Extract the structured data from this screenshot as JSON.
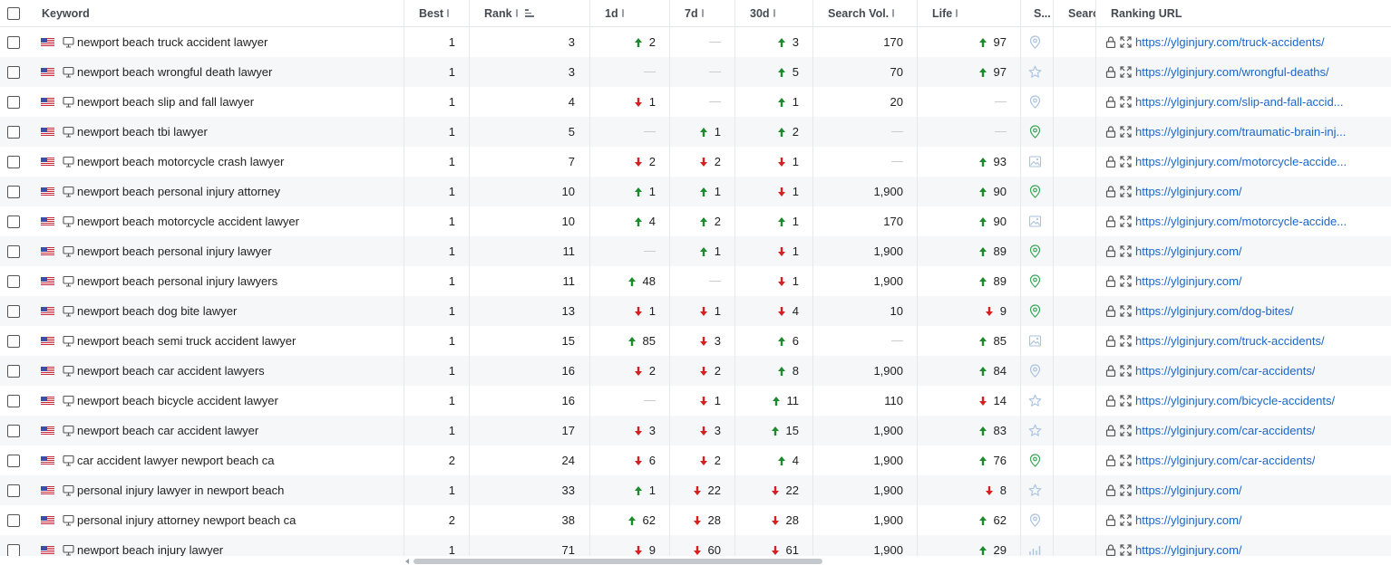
{
  "header": {
    "keyword": "Keyword",
    "best": "Best",
    "rank": "Rank",
    "d1": "1d",
    "d7": "7d",
    "d30": "30d",
    "search_vol": "Search Vol.",
    "life": "Life",
    "serp": "S...",
    "search": "Searc",
    "ranking_url": "Ranking URL"
  },
  "colors": {
    "up": "#1e8a2e",
    "down": "#d42020",
    "link": "#1a66c9"
  },
  "rows": [
    {
      "keyword": "newport beach truck accident lawyer",
      "flag": "us",
      "best": "1",
      "rank": "3",
      "d1": {
        "dir": "up",
        "v": "2"
      },
      "d7": {
        "dir": "none",
        "v": ""
      },
      "d30": {
        "dir": "up",
        "v": "3"
      },
      "vol": "170",
      "life": {
        "dir": "up",
        "v": "97"
      },
      "serp": "location-pin-icon",
      "serp_green": false,
      "url": "https://ylginjury.com/truck-accidents/"
    },
    {
      "keyword": "newport beach wrongful death lawyer",
      "flag": "us",
      "best": "1",
      "rank": "3",
      "d1": {
        "dir": "none",
        "v": ""
      },
      "d7": {
        "dir": "none",
        "v": ""
      },
      "d30": {
        "dir": "up",
        "v": "5"
      },
      "vol": "70",
      "life": {
        "dir": "up",
        "v": "97"
      },
      "serp": "star-icon",
      "serp_green": false,
      "url": "https://ylginjury.com/wrongful-deaths/"
    },
    {
      "keyword": "newport beach slip and fall lawyer",
      "flag": "us",
      "best": "1",
      "rank": "4",
      "d1": {
        "dir": "down",
        "v": "1"
      },
      "d7": {
        "dir": "none",
        "v": ""
      },
      "d30": {
        "dir": "up",
        "v": "1"
      },
      "vol": "20",
      "life": {
        "dir": "none",
        "v": ""
      },
      "serp": "location-pin-icon",
      "serp_green": false,
      "url": "https://ylginjury.com/slip-and-fall-accid..."
    },
    {
      "keyword": "newport beach tbi lawyer",
      "flag": "us",
      "best": "1",
      "rank": "5",
      "d1": {
        "dir": "none",
        "v": ""
      },
      "d7": {
        "dir": "up",
        "v": "1"
      },
      "d30": {
        "dir": "up",
        "v": "2"
      },
      "vol": "",
      "life": {
        "dir": "none",
        "v": ""
      },
      "serp": "location-pin-icon",
      "serp_green": true,
      "url": "https://ylginjury.com/traumatic-brain-inj..."
    },
    {
      "keyword": "newport beach motorcycle crash lawyer",
      "flag": "us",
      "best": "1",
      "rank": "7",
      "d1": {
        "dir": "down",
        "v": "2"
      },
      "d7": {
        "dir": "down",
        "v": "2"
      },
      "d30": {
        "dir": "down",
        "v": "1"
      },
      "vol": "",
      "life": {
        "dir": "up",
        "v": "93"
      },
      "serp": "image-icon",
      "serp_green": false,
      "url": "https://ylginjury.com/motorcycle-accide..."
    },
    {
      "keyword": "newport beach personal injury attorney",
      "flag": "us",
      "best": "1",
      "rank": "10",
      "d1": {
        "dir": "up",
        "v": "1"
      },
      "d7": {
        "dir": "up",
        "v": "1"
      },
      "d30": {
        "dir": "down",
        "v": "1"
      },
      "vol": "1,900",
      "life": {
        "dir": "up",
        "v": "90"
      },
      "serp": "location-pin-icon",
      "serp_green": true,
      "url": "https://ylginjury.com/"
    },
    {
      "keyword": "newport beach motorcycle accident lawyer",
      "flag": "us",
      "best": "1",
      "rank": "10",
      "d1": {
        "dir": "up",
        "v": "4"
      },
      "d7": {
        "dir": "up",
        "v": "2"
      },
      "d30": {
        "dir": "up",
        "v": "1"
      },
      "vol": "170",
      "life": {
        "dir": "up",
        "v": "90"
      },
      "serp": "image-icon",
      "serp_green": false,
      "url": "https://ylginjury.com/motorcycle-accide..."
    },
    {
      "keyword": "newport beach personal injury lawyer",
      "flag": "us",
      "best": "1",
      "rank": "11",
      "d1": {
        "dir": "none",
        "v": ""
      },
      "d7": {
        "dir": "up",
        "v": "1"
      },
      "d30": {
        "dir": "down",
        "v": "1"
      },
      "vol": "1,900",
      "life": {
        "dir": "up",
        "v": "89"
      },
      "serp": "location-pin-icon",
      "serp_green": true,
      "url": "https://ylginjury.com/"
    },
    {
      "keyword": "newport beach personal injury lawyers",
      "flag": "us",
      "best": "1",
      "rank": "11",
      "d1": {
        "dir": "up",
        "v": "48"
      },
      "d7": {
        "dir": "none",
        "v": ""
      },
      "d30": {
        "dir": "down",
        "v": "1"
      },
      "vol": "1,900",
      "life": {
        "dir": "up",
        "v": "89"
      },
      "serp": "location-pin-icon",
      "serp_green": true,
      "url": "https://ylginjury.com/"
    },
    {
      "keyword": "newport beach dog bite lawyer",
      "flag": "us",
      "best": "1",
      "rank": "13",
      "d1": {
        "dir": "down",
        "v": "1"
      },
      "d7": {
        "dir": "down",
        "v": "1"
      },
      "d30": {
        "dir": "down",
        "v": "4"
      },
      "vol": "10",
      "life": {
        "dir": "down",
        "v": "9"
      },
      "serp": "location-pin-icon",
      "serp_green": true,
      "url": "https://ylginjury.com/dog-bites/"
    },
    {
      "keyword": "newport beach semi truck accident lawyer",
      "flag": "us",
      "best": "1",
      "rank": "15",
      "d1": {
        "dir": "up",
        "v": "85"
      },
      "d7": {
        "dir": "down",
        "v": "3"
      },
      "d30": {
        "dir": "up",
        "v": "6"
      },
      "vol": "",
      "life": {
        "dir": "up",
        "v": "85"
      },
      "serp": "image-icon",
      "serp_green": false,
      "url": "https://ylginjury.com/truck-accidents/"
    },
    {
      "keyword": "newport beach car accident lawyers",
      "flag": "us",
      "best": "1",
      "rank": "16",
      "d1": {
        "dir": "down",
        "v": "2"
      },
      "d7": {
        "dir": "down",
        "v": "2"
      },
      "d30": {
        "dir": "up",
        "v": "8"
      },
      "vol": "1,900",
      "life": {
        "dir": "up",
        "v": "84"
      },
      "serp": "location-pin-icon",
      "serp_green": false,
      "url": "https://ylginjury.com/car-accidents/"
    },
    {
      "keyword": "newport beach bicycle accident lawyer",
      "flag": "us",
      "best": "1",
      "rank": "16",
      "d1": {
        "dir": "none",
        "v": ""
      },
      "d7": {
        "dir": "down",
        "v": "1"
      },
      "d30": {
        "dir": "up",
        "v": "11"
      },
      "vol": "110",
      "life": {
        "dir": "down",
        "v": "14"
      },
      "serp": "star-icon",
      "serp_green": false,
      "url": "https://ylginjury.com/bicycle-accidents/"
    },
    {
      "keyword": "newport beach car accident lawyer",
      "flag": "us",
      "best": "1",
      "rank": "17",
      "d1": {
        "dir": "down",
        "v": "3"
      },
      "d7": {
        "dir": "down",
        "v": "3"
      },
      "d30": {
        "dir": "up",
        "v": "15"
      },
      "vol": "1,900",
      "life": {
        "dir": "up",
        "v": "83"
      },
      "serp": "star-icon",
      "serp_green": false,
      "url": "https://ylginjury.com/car-accidents/"
    },
    {
      "keyword": "car accident lawyer newport beach ca",
      "flag": "us",
      "best": "2",
      "rank": "24",
      "d1": {
        "dir": "down",
        "v": "6"
      },
      "d7": {
        "dir": "down",
        "v": "2"
      },
      "d30": {
        "dir": "up",
        "v": "4"
      },
      "vol": "1,900",
      "life": {
        "dir": "up",
        "v": "76"
      },
      "serp": "location-pin-icon",
      "serp_green": true,
      "url": "https://ylginjury.com/car-accidents/"
    },
    {
      "keyword": "personal injury lawyer in newport beach",
      "flag": "us",
      "best": "1",
      "rank": "33",
      "d1": {
        "dir": "up",
        "v": "1"
      },
      "d7": {
        "dir": "down",
        "v": "22"
      },
      "d30": {
        "dir": "down",
        "v": "22"
      },
      "vol": "1,900",
      "life": {
        "dir": "down",
        "v": "8"
      },
      "serp": "star-icon",
      "serp_green": false,
      "url": "https://ylginjury.com/"
    },
    {
      "keyword": "personal injury attorney newport beach ca",
      "flag": "us",
      "best": "2",
      "rank": "38",
      "d1": {
        "dir": "up",
        "v": "62"
      },
      "d7": {
        "dir": "down",
        "v": "28"
      },
      "d30": {
        "dir": "down",
        "v": "28"
      },
      "vol": "1,900",
      "life": {
        "dir": "up",
        "v": "62"
      },
      "serp": "location-pin-icon",
      "serp_green": false,
      "url": "https://ylginjury.com/"
    },
    {
      "keyword": "newport beach injury lawyer",
      "flag": "us",
      "best": "1",
      "rank": "71",
      "d1": {
        "dir": "down",
        "v": "9"
      },
      "d7": {
        "dir": "down",
        "v": "60"
      },
      "d30": {
        "dir": "down",
        "v": "61"
      },
      "vol": "1,900",
      "life": {
        "dir": "up",
        "v": "29"
      },
      "serp": "chart-icon",
      "serp_green": false,
      "url": "https://ylginjury.com/"
    }
  ]
}
